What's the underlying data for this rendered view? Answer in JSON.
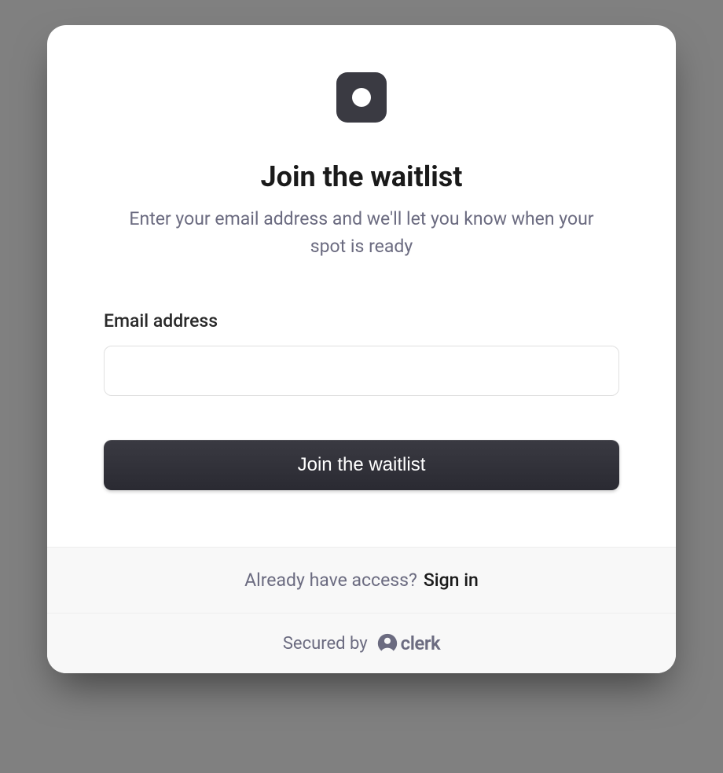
{
  "header": {
    "title": "Join the waitlist",
    "subtitle": "Enter your email address and we'll let you know when your spot is ready"
  },
  "form": {
    "email_label": "Email address",
    "email_value": "",
    "submit_label": "Join the waitlist"
  },
  "footer": {
    "access_text": "Already have access?",
    "sign_in_label": "Sign in",
    "secured_by": "Secured by",
    "brand": "clerk"
  }
}
